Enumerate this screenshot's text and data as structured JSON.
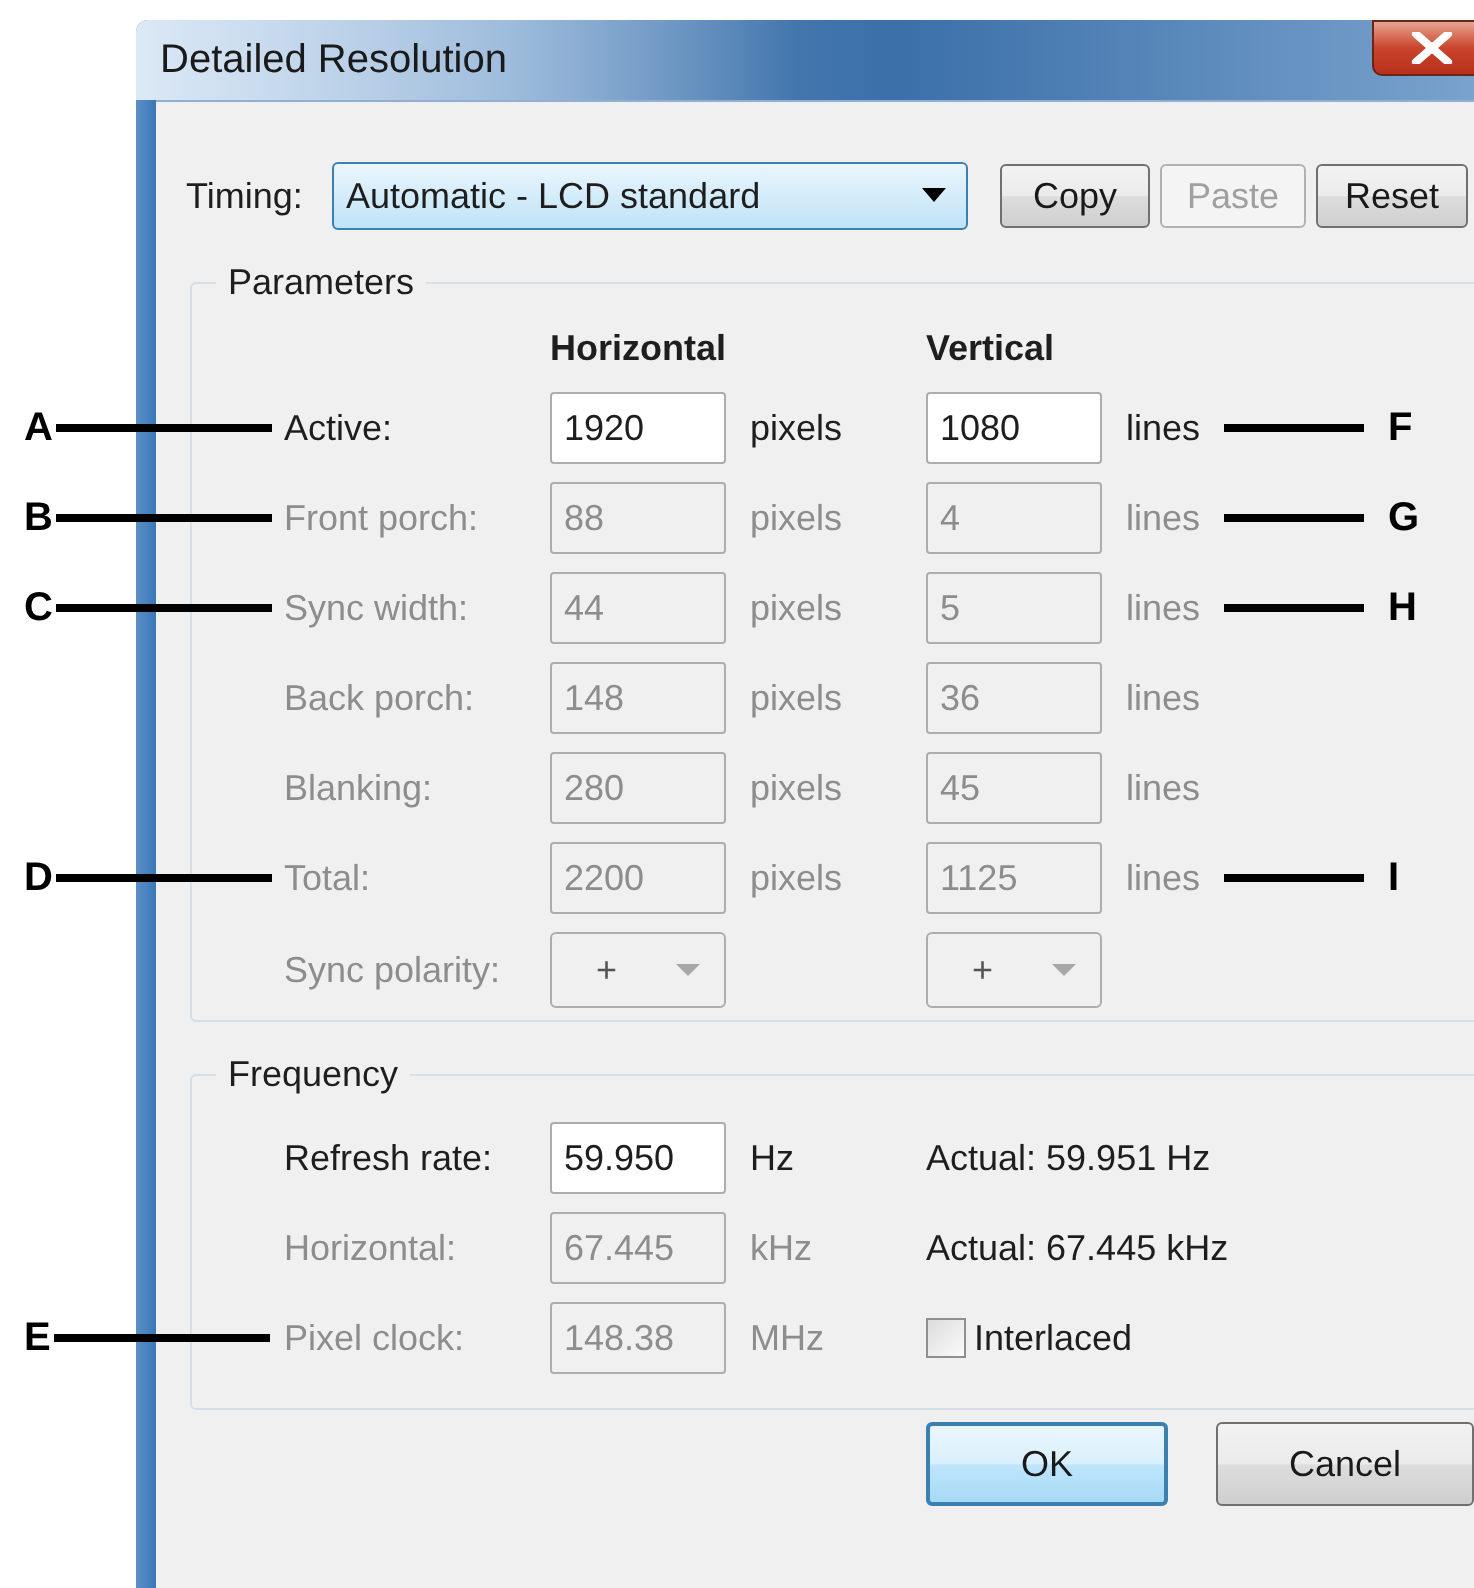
{
  "window": {
    "title": "Detailed Resolution"
  },
  "timing": {
    "label": "Timing:",
    "value": "Automatic - LCD standard"
  },
  "buttons": [
    {
      "label": "Copy",
      "disabled": false
    },
    {
      "label": "Paste",
      "disabled": true
    },
    {
      "label": "Reset",
      "disabled": false
    }
  ],
  "parameters": {
    "title": "Parameters",
    "columns": [
      "Horizontal",
      "Vertical"
    ],
    "rows": [
      {
        "kind": "field",
        "label": "Active:",
        "disabled": false,
        "horizontal": "1920",
        "horizontal_unit": "pixels",
        "vertical": "1080",
        "vertical_unit": "lines",
        "callout_left": "A",
        "callout_right": "F"
      },
      {
        "kind": "field",
        "label": "Front porch:",
        "disabled": true,
        "horizontal": "88",
        "horizontal_unit": "pixels",
        "vertical": "4",
        "vertical_unit": "lines",
        "callout_left": "B",
        "callout_right": "G"
      },
      {
        "kind": "field",
        "label": "Sync width:",
        "disabled": true,
        "horizontal": "44",
        "horizontal_unit": "pixels",
        "vertical": "5",
        "vertical_unit": "lines",
        "callout_left": "C",
        "callout_right": "H"
      },
      {
        "kind": "field",
        "label": "Back porch:",
        "disabled": true,
        "horizontal": "148",
        "horizontal_unit": "pixels",
        "vertical": "36",
        "vertical_unit": "lines"
      },
      {
        "kind": "field",
        "label": "Blanking:",
        "disabled": true,
        "horizontal": "280",
        "horizontal_unit": "pixels",
        "vertical": "45",
        "vertical_unit": "lines"
      },
      {
        "kind": "field",
        "label": "Total:",
        "disabled": true,
        "horizontal": "2200",
        "horizontal_unit": "pixels",
        "vertical": "1125",
        "vertical_unit": "lines",
        "callout_left": "D",
        "callout_right": "I"
      },
      {
        "kind": "dropdown",
        "label": "Sync polarity:",
        "disabled": true,
        "horizontal": "+",
        "vertical": "+"
      }
    ]
  },
  "frequency": {
    "title": "Frequency",
    "rows": [
      {
        "label": "Refresh rate:",
        "disabled": false,
        "value": "59.950",
        "unit": "Hz",
        "extra": {
          "kind": "text",
          "text": "Actual: 59.951 Hz"
        }
      },
      {
        "label": "Horizontal:",
        "disabled": true,
        "value": "67.445",
        "unit": "kHz",
        "extra": {
          "kind": "text",
          "text": "Actual: 67.445 kHz"
        }
      },
      {
        "label": "Pixel clock:",
        "disabled": true,
        "value": "148.38",
        "unit": "MHz",
        "callout_left": "E",
        "extra": {
          "kind": "checkbox",
          "label": "Interlaced",
          "checked": false
        }
      }
    ]
  },
  "dialog_buttons": [
    {
      "label": "OK",
      "default": true
    },
    {
      "label": "Cancel",
      "default": false
    }
  ]
}
